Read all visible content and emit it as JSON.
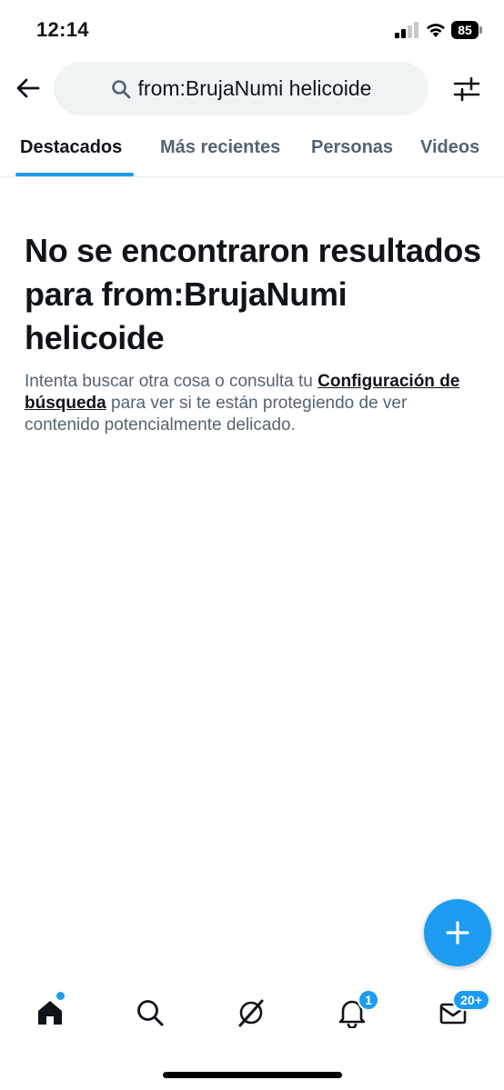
{
  "status_bar": {
    "time": "12:14",
    "battery": "85"
  },
  "header": {
    "search_query": "from:BrujaNumi helicoide",
    "icons": {
      "back": "arrow-left-icon",
      "search": "search-icon",
      "filter": "sliders-icon"
    }
  },
  "tabs": [
    {
      "label": "Destacados",
      "active": true
    },
    {
      "label": "Más recientes",
      "active": false
    },
    {
      "label": "Personas",
      "active": false
    },
    {
      "label": "Videos",
      "active": false
    }
  ],
  "empty_state": {
    "title": "No se encontraron resultados para from:BrujaNumi helicoide",
    "desc_before": "Intenta buscar otra cosa o consulta tu ",
    "link": "Configuración de búsqueda",
    "desc_after": " para ver si te están protegiendo de ver contenido potencialmente delicado."
  },
  "bottom_nav": {
    "items": [
      "home-icon",
      "search-icon",
      "grok-icon",
      "bell-icon",
      "mail-icon"
    ],
    "notifications_badge": "1",
    "messages_badge": "20+"
  },
  "colors": {
    "accent": "#1d9bf0",
    "text_primary": "#0f1419",
    "text_secondary": "#536471",
    "search_bg": "#eff3f4"
  }
}
